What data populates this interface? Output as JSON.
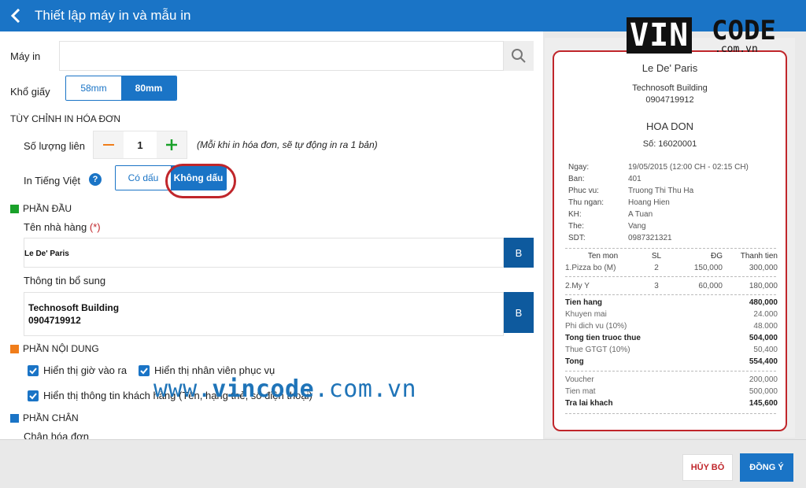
{
  "header": {
    "title": "Thiết lập máy in và mẫu in"
  },
  "logo": {
    "brand": "VIN",
    "code": "CODE",
    "domain": ".com.vn"
  },
  "printer": {
    "label": "Máy in",
    "value": ""
  },
  "paper": {
    "label": "Khổ giấy",
    "options": [
      "58mm",
      "80mm"
    ],
    "selected": "80mm"
  },
  "customize": {
    "title": "TÙY CHỈNH IN HÓA ĐƠN",
    "copies_label": "Số lượng liên",
    "copies_value": "1",
    "copies_note": "(Mỗi khi in hóa đơn, sẽ tự động in ra 1 bản)",
    "vn_label": "In Tiếng Việt",
    "vn_help": "?",
    "vn_options": [
      "Có dấu",
      "Không dấu"
    ],
    "vn_selected": "Không dấu"
  },
  "header_section": {
    "title": "PHẦN ĐẦU",
    "restaurant_label": "Tên nhà hàng",
    "required_mark": "(*)",
    "restaurant_value": "Le De' Paris",
    "bold_label": "B",
    "extra_label": "Thông tin bổ sung",
    "extra_line1": "Technosoft Building",
    "extra_line2": "0904719912"
  },
  "content_section": {
    "title": "PHẦN NỘI DUNG",
    "checks": [
      {
        "label": "Hiển thị giờ vào ra",
        "checked": true
      },
      {
        "label": "Hiển thị nhân viên phục vụ",
        "checked": true
      },
      {
        "label": "Hiển thị thông tin khách hàng (Tên, hạng thẻ, số điện thoại)",
        "checked": true
      }
    ]
  },
  "footer_section": {
    "title": "PHẦN CHÂN",
    "footer_label": "Chân hóa đơn"
  },
  "watermark": {
    "pre": "www.",
    "brand": "vincode",
    "post": ".com.vn"
  },
  "receipt": {
    "name": "Le De' Paris",
    "address": "Technosoft Building",
    "phone": "0904719912",
    "doc_title": "HOA DON",
    "number": "Số: 16020001",
    "info": [
      {
        "k": "Ngay:",
        "v": "19/05/2015 (12:00 CH - 02:15 CH)"
      },
      {
        "k": "Ban:",
        "v": "401"
      },
      {
        "k": "Phuc vu:",
        "v": "Truong Thi Thu Ha"
      },
      {
        "k": "Thu ngan:",
        "v": "Hoang Hien"
      },
      {
        "k": "KH:",
        "v": "A Tuan"
      },
      {
        "k": "The:",
        "v": "Vang"
      },
      {
        "k": "SDT:",
        "v": "0987321321"
      }
    ],
    "columns": [
      "Ten mon",
      "SL",
      "ĐG",
      "Thanh tien"
    ],
    "items": [
      {
        "name": "1.Pizza bo (M)",
        "qty": "2",
        "price": "150,000",
        "total": "300,000"
      },
      {
        "name": "2.My Y",
        "qty": "3",
        "price": "60,000",
        "total": "180,000"
      }
    ],
    "summary": [
      {
        "k": "Tien hang",
        "v": "480,000",
        "bold": true
      },
      {
        "k": "Khuyen mai",
        "v": "24.000",
        "bold": false
      },
      {
        "k": "Phi dich vu (10%)",
        "v": "48.000",
        "bold": false
      },
      {
        "k": "Tong tien truoc thue",
        "v": "504,000",
        "bold": true
      },
      {
        "k": "Thue GTGT (10%)",
        "v": "50,400",
        "bold": false
      },
      {
        "k": "Tong",
        "v": "554,400",
        "bold": true
      }
    ],
    "payments": [
      {
        "k": "Voucher",
        "v": "200,000",
        "bold": false
      },
      {
        "k": "Tien mat",
        "v": "500,000",
        "bold": false
      },
      {
        "k": "Tra lai khach",
        "v": "145,600",
        "bold": true
      }
    ]
  },
  "actions": {
    "cancel": "HỦY BỎ",
    "ok": "ĐỒNG Ý"
  },
  "colors": {
    "primary": "#1a74c6",
    "dark_button": "#0e5a9e",
    "highlight": "#c0262b",
    "green": "#1aa12a",
    "orange": "#f07d1a",
    "blue_square": "#1a74c6"
  }
}
